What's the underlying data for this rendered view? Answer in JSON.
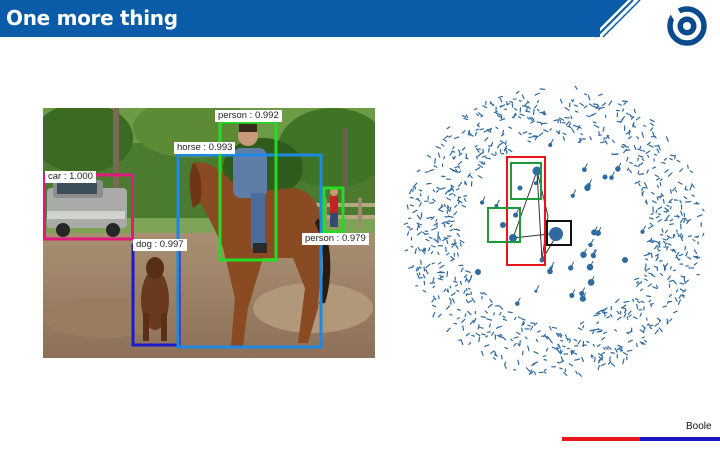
{
  "slide": {
    "title": "One more thing",
    "brand": "Boole"
  },
  "detections": [
    {
      "label": "car : 1.000"
    },
    {
      "label": "dog : 0.997"
    },
    {
      "label": "horse : 0.993"
    },
    {
      "label": "person : 0.992"
    },
    {
      "label": "person : 0.979"
    }
  ],
  "colors": {
    "header": "#0b5ca8",
    "car_box": "#e0197d",
    "dog_box": "#1a1ac8",
    "horse_box": "#1e88e5",
    "person_box": "#22dd22",
    "graph_node": "#2f6aa0",
    "accent_red": "#e8141b",
    "accent_blue": "#1a17c9"
  }
}
